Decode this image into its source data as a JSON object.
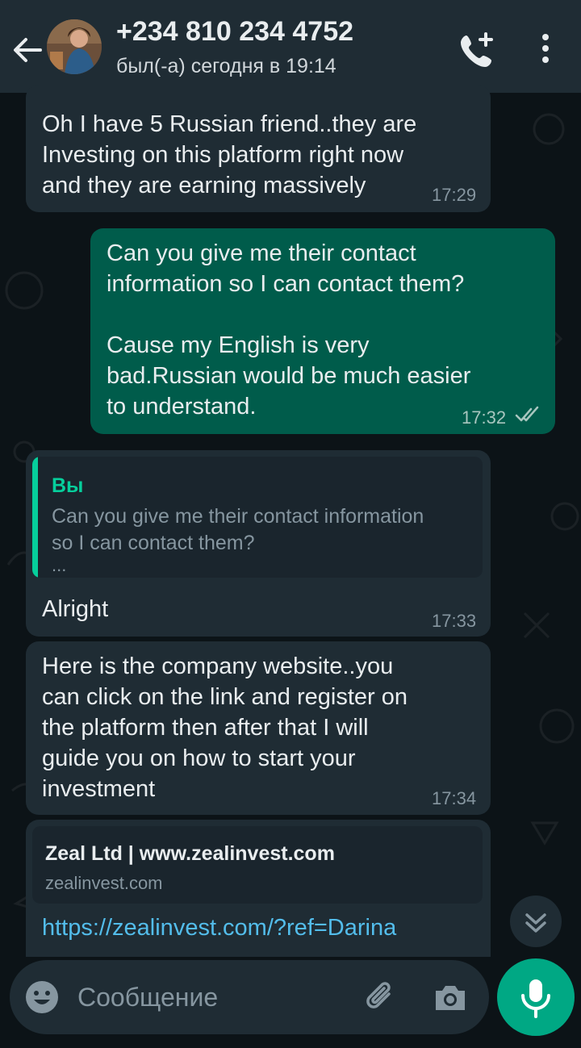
{
  "header": {
    "contact_name": "+234 810 234 4752",
    "status": "был(-а) сегодня в 19:14"
  },
  "messages": [
    {
      "direction": "incoming",
      "text": "Oh I have 5 Russian friend..they are\nInvesting on this platform right now\nand they are earning massively",
      "time": "17:29"
    },
    {
      "direction": "outgoing",
      "text": "Can you give me their contact\ninformation so I can contact them?\n\nCause my English is very\nbad.Russian would be much easier\nto understand.",
      "time": "17:32",
      "status_icon": "double-check-icon"
    },
    {
      "direction": "incoming",
      "quote": {
        "author": "Вы",
        "text": "Can you give me their contact information\nso I can contact them?",
        "more": "..."
      },
      "text": "Alright",
      "time": "17:33"
    },
    {
      "direction": "incoming",
      "text": "Here is the company website..you\ncan click on the link and register on\nthe platform then after that I will\nguide you on how to start your\ninvestment",
      "time": "17:34"
    },
    {
      "direction": "incoming",
      "link_preview": {
        "title": "Zeal Ltd | www.zealinvest.com",
        "domain": "zealinvest.com"
      },
      "url": "https://zealinvest.com/?ref=Darina"
    }
  ],
  "composer": {
    "placeholder": "Сообщение"
  },
  "colors": {
    "header_bg": "#1f2c34",
    "incoming_bubble": "#1f2c34",
    "outgoing_bubble": "#005c4b",
    "accent": "#00a884",
    "link": "#53bdeb"
  }
}
